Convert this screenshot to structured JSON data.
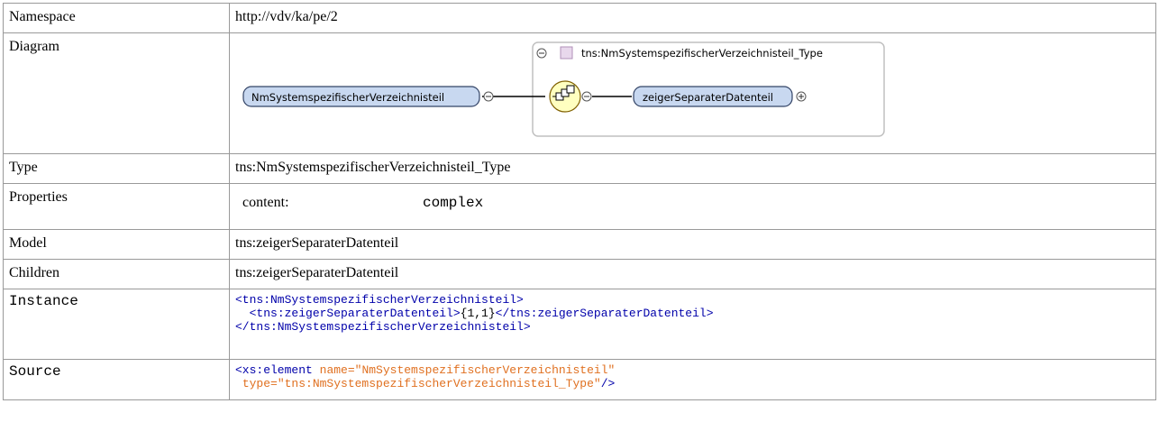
{
  "rows": {
    "namespace": {
      "label": "Namespace",
      "value": "http://vdv/ka/pe/2"
    },
    "diagram": {
      "label": "Diagram",
      "element_name": "NmSystemspezifischerVerzeichnisteil",
      "type_name": "tns:NmSystemspezifischerVerzeichnisteil_Type",
      "child_name": "zeigerSeparaterDatenteil"
    },
    "type": {
      "label": "Type",
      "value": "tns:NmSystemspezifischerVerzeichnisteil_Type"
    },
    "properties": {
      "label": "Properties",
      "key": "content:",
      "value": "complex"
    },
    "model": {
      "label": "Model",
      "value": "tns:zeigerSeparaterDatenteil"
    },
    "children": {
      "label": "Children",
      "value": "tns:zeigerSeparaterDatenteil"
    },
    "instance": {
      "label": "Instance",
      "line1": "<tns:NmSystemspezifischerVerzeichnisteil>",
      "line2_open": "<tns:zeigerSeparaterDatenteil>",
      "line2_text": "{1,1}",
      "line2_close": "</tns:zeigerSeparaterDatenteil>",
      "line3": "</tns:NmSystemspezifischerVerzeichnisteil>"
    },
    "source": {
      "label": "Source",
      "line1_tag": "<xs:element",
      "line1_attr": "name=\"NmSystemspezifischerVerzeichnisteil\"",
      "line2_attr": "type=\"tns:NmSystemspezifischerVerzeichnisteil_Type\"",
      "line2_end": "/>"
    }
  },
  "colors": {
    "border": "#999999",
    "tag": "#0000aa",
    "attribute": "#e07020",
    "element_fill": "#c8d8f0",
    "sequence_fill": "#ffffc0"
  },
  "icons": [
    "collapse-icon",
    "expand-icon",
    "sequence-icon",
    "type-box-icon"
  ]
}
